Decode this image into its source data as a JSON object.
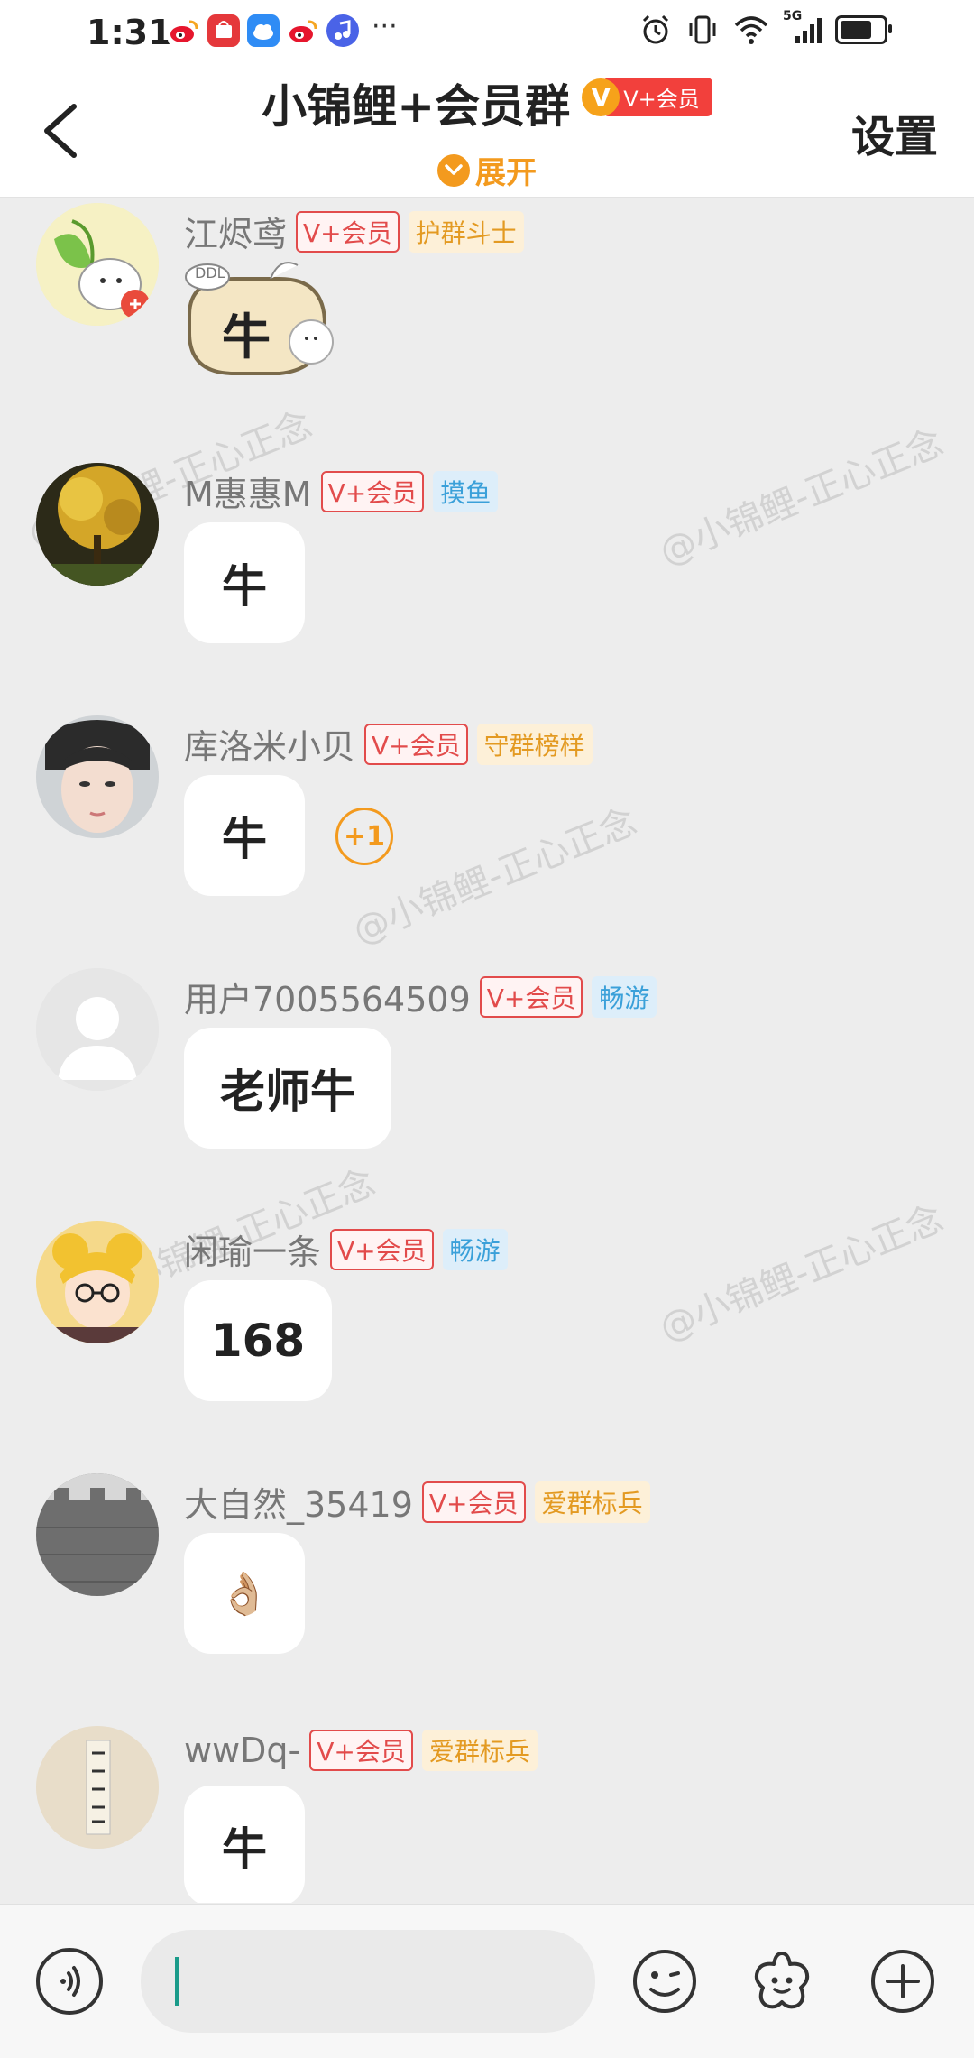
{
  "status_bar": {
    "time": "1:31",
    "network": "5G",
    "battery_level": 0.85
  },
  "header": {
    "title": "小锦鲤+会员群",
    "vip_badge": {
      "letter": "V",
      "label": "V+会员"
    },
    "expand_label": "展开",
    "settings_label": "设置"
  },
  "watermark": "@小锦鲤-正心正念",
  "messages": [
    {
      "name": "江烬鸢",
      "vip": "V+会员",
      "rank": "护群斗士",
      "rank_color": "orange",
      "content": "牛",
      "type": "sticker",
      "sticker_tag": "DDL"
    },
    {
      "name": "M惠惠M",
      "vip": "V+会员",
      "rank": "摸鱼",
      "rank_color": "blue",
      "content": "牛",
      "type": "text"
    },
    {
      "name": "库洛米小贝",
      "vip": "V+会员",
      "rank": "守群榜样",
      "rank_color": "orange",
      "content": "牛",
      "type": "text",
      "plus_one": "+1"
    },
    {
      "name": "用户7005564509",
      "vip": "V+会员",
      "rank": "畅游",
      "rank_color": "blue",
      "content": "老师牛",
      "type": "text"
    },
    {
      "name": "闲瑜一条",
      "vip": "V+会员",
      "rank": "畅游",
      "rank_color": "blue",
      "content": "168",
      "type": "text"
    },
    {
      "name": "大自然_35419",
      "vip": "V+会员",
      "rank": "爱群标兵",
      "rank_color": "orange",
      "content": "👌🏼",
      "type": "emoji"
    },
    {
      "name": "wwDq-",
      "vip": "V+会员",
      "rank": "爱群标兵",
      "rank_color": "orange",
      "content": "牛",
      "type": "text"
    }
  ],
  "input_bar": {
    "icons": [
      "voice-icon",
      "emoji-icon",
      "sticker-icon",
      "plus-icon"
    ],
    "placeholder": ""
  }
}
